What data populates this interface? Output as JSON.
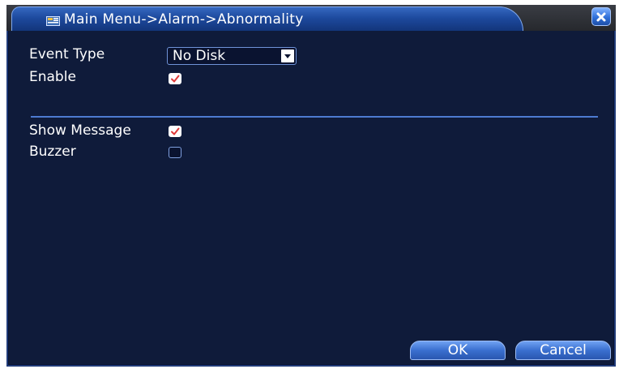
{
  "window": {
    "title": "Main Menu->Alarm->Abnormality",
    "title_icon": "menu-folder-icon",
    "close_icon": "close-icon"
  },
  "form": {
    "event_type_label": "Event Type",
    "event_type_value": "No Disk",
    "enable_label": "Enable",
    "enable_checked": true,
    "show_message_label": "Show Message",
    "show_message_checked": true,
    "buzzer_label": "Buzzer",
    "buzzer_checked": false
  },
  "buttons": {
    "ok_label": "OK",
    "cancel_label": "Cancel"
  },
  "colors": {
    "background": "#0f1b3a",
    "title_tab": "#1d4a9e",
    "accent": "#3a6fcf",
    "check_mark": "#e03a3a"
  }
}
